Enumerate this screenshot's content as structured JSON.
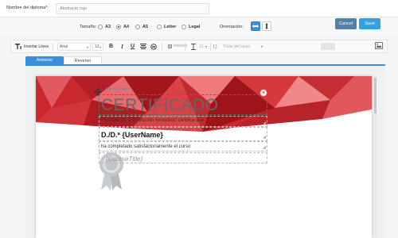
{
  "name_field": {
    "label": "Nombre del diploma*:",
    "value": "Abstracto rojo"
  },
  "settings": {
    "size_label": "Tamaño:",
    "sizes": [
      {
        "label": "A3",
        "selected": false
      },
      {
        "label": "A4",
        "selected": true
      },
      {
        "label": "A5",
        "selected": false
      },
      {
        "label": "Letter",
        "selected": false
      },
      {
        "label": "Legal",
        "selected": false
      }
    ],
    "orientation_label": "Orientación:",
    "orientation": "landscape",
    "cancel_label": "Cancel",
    "save_label": "Save"
  },
  "toolbar": {
    "insert_line_label": "Insertar Línea",
    "font": "Arial",
    "font_size": "12",
    "bold_icon": "B",
    "italic_icon": "I",
    "underline_icon": "U",
    "color_value": "#000000",
    "line_height": "12",
    "course_title_placeholder": "Título del curso",
    "braces_icon": "{ }"
  },
  "tabs": [
    {
      "label": "Anverso",
      "active": true
    },
    {
      "label": "Reverso",
      "active": false
    }
  ],
  "certificate": {
    "dimensions_label": "X: 82mm Y:88mm",
    "title": "CERTIFICADO",
    "institution_line": "\"Nombre de la institución formativa\" certifica que",
    "username_line": "D./D.ª {UserName}",
    "completed_line": "ha completado satisfactoriamente el curso",
    "course_line": "{CourseTitle}"
  },
  "colors": {
    "accent": "#3b8fd9",
    "cancel": "#5581a8",
    "save": "#37a0e0",
    "banner_red": "#c8282e",
    "close_red": "#e0463a"
  }
}
